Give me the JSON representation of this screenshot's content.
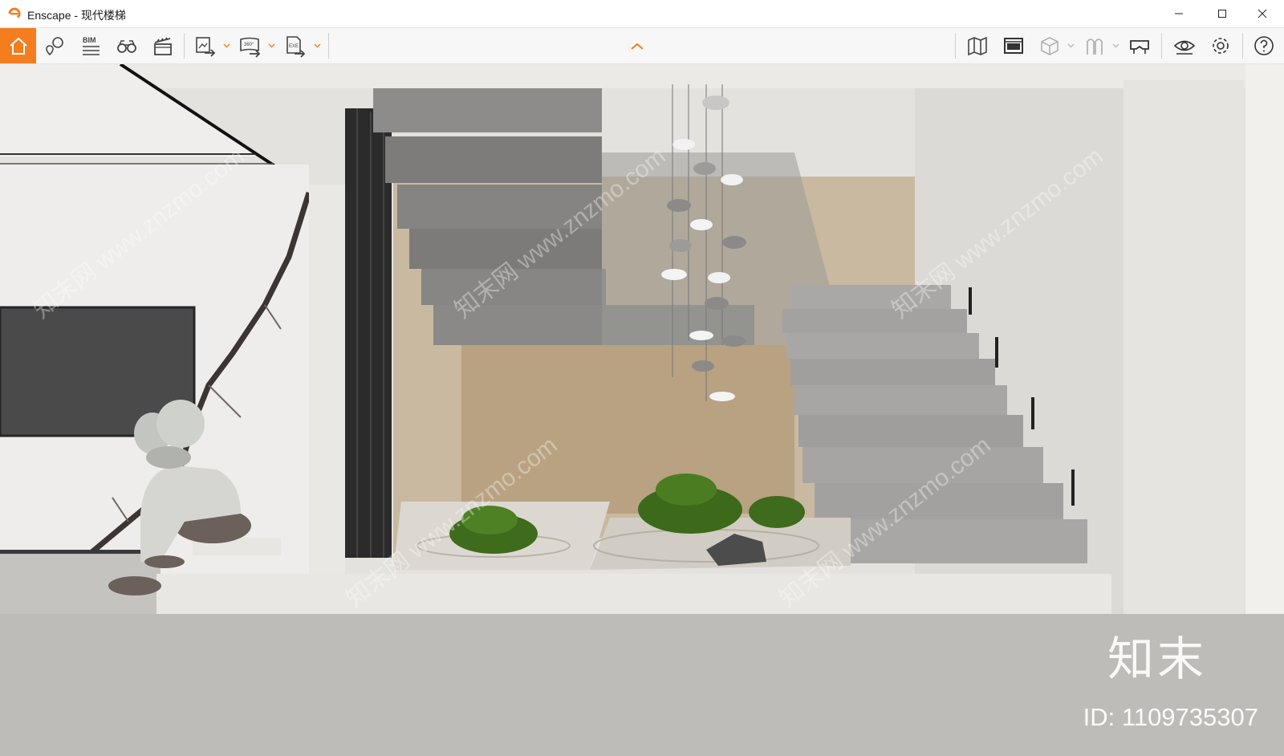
{
  "window": {
    "app_name": "Enscape",
    "separator": " - ",
    "document_name": "现代楼梯",
    "brand_color": "#f47d20"
  },
  "toolbar": {
    "left_icons": [
      "home-icon",
      "location-pin-icon",
      "bim-icon",
      "binoculars-icon",
      "clapperboard-icon",
      "export-image-icon",
      "export-panorama-icon",
      "export-exe-icon"
    ],
    "bim_label": "BIM",
    "panorama_label": "360°",
    "exe_label": "EXE",
    "right_icons": [
      "map-icon",
      "asset-library-icon",
      "cube-view-icon",
      "material-editor-icon",
      "vr-headset-icon",
      "visual-settings-icon",
      "settings-icon",
      "help-icon"
    ]
  },
  "viewport": {
    "watermark_logo": "知末",
    "watermark_id": "ID: 1109735307",
    "watermark_text": "知末网 www.znzmo.com"
  }
}
